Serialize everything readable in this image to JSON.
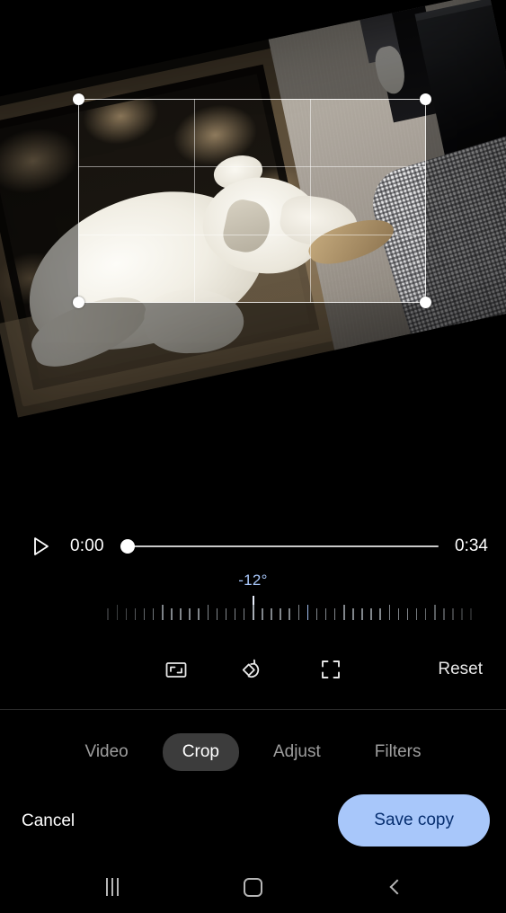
{
  "editor": {
    "mode": "crop",
    "rotation_label": "-12°",
    "rotation_degrees": -12
  },
  "player": {
    "play_icon": "play-triangle-icon",
    "current_time": "0:00",
    "total_time": "0:34",
    "progress_percent": 0
  },
  "crop": {
    "grid": "rule-of-thirds",
    "handles": [
      "top-left",
      "top-right",
      "bottom-left",
      "bottom-right"
    ]
  },
  "tools": [
    {
      "name": "aspect-ratio",
      "icon": "aspect-ratio-icon"
    },
    {
      "name": "rotate",
      "icon": "rotate-left-icon"
    },
    {
      "name": "free-crop",
      "icon": "free-crop-icon"
    }
  ],
  "reset": {
    "label": "Reset"
  },
  "tabs": [
    {
      "id": "video",
      "label": "Video",
      "active": false
    },
    {
      "id": "crop",
      "label": "Crop",
      "active": true
    },
    {
      "id": "adjust",
      "label": "Adjust",
      "active": false
    },
    {
      "id": "filters",
      "label": "Filters",
      "active": false
    }
  ],
  "actions": {
    "cancel_label": "Cancel",
    "save_label": "Save copy"
  },
  "navbar": {
    "recents": "recents-icon",
    "home": "home-icon",
    "back": "back-icon"
  },
  "colors": {
    "background": "#000000",
    "accent_blue": "#a8c7fa",
    "save_text": "#062e6f",
    "tab_active_bg": "#3c3c3c",
    "tick": "#9aa0a6"
  }
}
